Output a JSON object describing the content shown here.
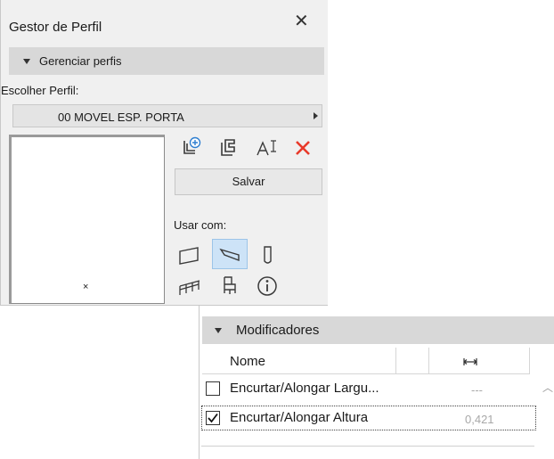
{
  "profile_manager": {
    "title": "Gestor de Perfil",
    "close_symbol": "✕",
    "section_label": "Gerenciar perfis",
    "choose_label": "Escolher Perfil:",
    "selected_profile": "00 MOVEL ESP. PORTA",
    "list_marker": "×",
    "save_label": "Salvar",
    "use_with_label": "Usar com:",
    "tool_icons": [
      "new-profile-icon",
      "duplicate-profile-icon",
      "rename-profile-icon",
      "delete-profile-icon"
    ],
    "element_types": [
      "wall-icon",
      "beam-icon",
      "column-icon",
      "railing-icon",
      "object-icon",
      "info-icon"
    ],
    "selected_element_type": "beam-icon",
    "colors": {
      "delete": "#e8392a",
      "selected_bg": "#cde3f7"
    }
  },
  "modifiers": {
    "section_label": "Modificadores",
    "columns": {
      "name": "Nome",
      "width_icon": "width-measure-icon"
    },
    "rows": [
      {
        "checked": false,
        "name": "Encurtar/Alongar Largu...",
        "value": "---"
      },
      {
        "checked": true,
        "name": "Encurtar/Alongar Altura",
        "value": "0,421"
      }
    ]
  }
}
